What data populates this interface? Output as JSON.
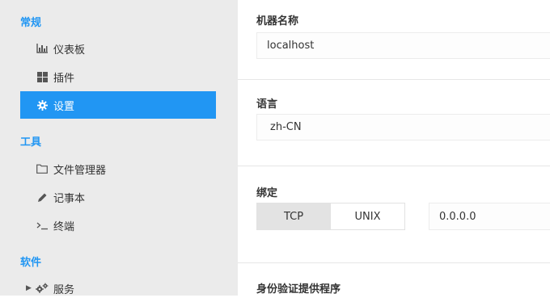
{
  "sidebar": {
    "sections": [
      {
        "title": "常规"
      },
      {
        "title": "工具"
      },
      {
        "title": "软件"
      }
    ],
    "items": [
      {
        "label": "仪表板",
        "icon": "bar-chart-icon"
      },
      {
        "label": "插件",
        "icon": "grid-icon"
      },
      {
        "label": "设置",
        "icon": "gear-icon",
        "active": true
      },
      {
        "label": "文件管理器",
        "icon": "folder-icon"
      },
      {
        "label": "记事本",
        "icon": "pencil-icon"
      },
      {
        "label": "终端",
        "icon": "terminal-icon"
      },
      {
        "label": "服务",
        "icon": "cogs-icon"
      }
    ]
  },
  "settings": {
    "machine_name": {
      "label": "机器名称",
      "value": "localhost"
    },
    "language": {
      "label": "语言",
      "value": "zh-CN"
    },
    "bind": {
      "label": "绑定",
      "options": [
        "TCP",
        "UNIX"
      ],
      "selected": "TCP",
      "address": "0.0.0.0"
    },
    "auth": {
      "label": "身份验证提供程序"
    }
  },
  "colors": {
    "accent": "#2196f3",
    "sidebar_bg": "#ebebeb"
  }
}
